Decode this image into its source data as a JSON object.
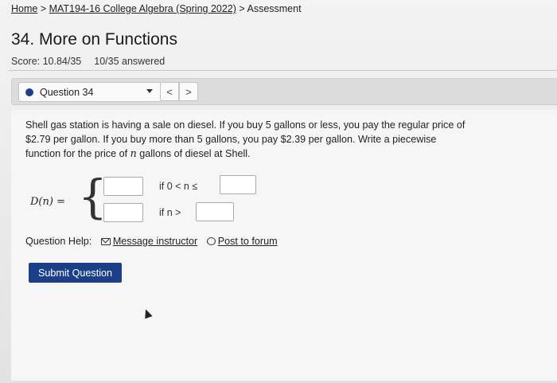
{
  "breadcrumb": {
    "home": "Home",
    "sep1": " > ",
    "course": "MAT194-16 College Algebra (Spring 2022)",
    "sep2": " > ",
    "current": "Assessment"
  },
  "page": {
    "title": "34. More on Functions",
    "score": "Score: 10.84/35",
    "answered": "10/35 answered"
  },
  "question_nav": {
    "selected": "Question 34",
    "prev_label": "<",
    "next_label": ">"
  },
  "question": {
    "line1": "Shell gas station is having a sale on diesel. If you buy 5 gallons or less, you pay the regular price of",
    "line2": "$2.79 per gallon. If you buy more than 5 gallons, you pay $2.39 per gallon. Write a piecewise",
    "line3_pre": "function for the price of ",
    "line3_var": "n",
    "line3_post": " gallons of diesel at Shell.",
    "function_label": "D(n) =",
    "brace": "{",
    "cond1": "if 0 < n ≤",
    "cond2": "if n >",
    "inputs": {
      "expr1": "",
      "bound1": "",
      "expr2": "",
      "bound2": ""
    }
  },
  "help": {
    "label": "Question Help:",
    "message": "Message instructor",
    "forum": "Post to forum"
  },
  "submit_label": "Submit Question",
  "colors": {
    "accent": "#1d3f8a",
    "bullet": "#1d3f8a"
  }
}
